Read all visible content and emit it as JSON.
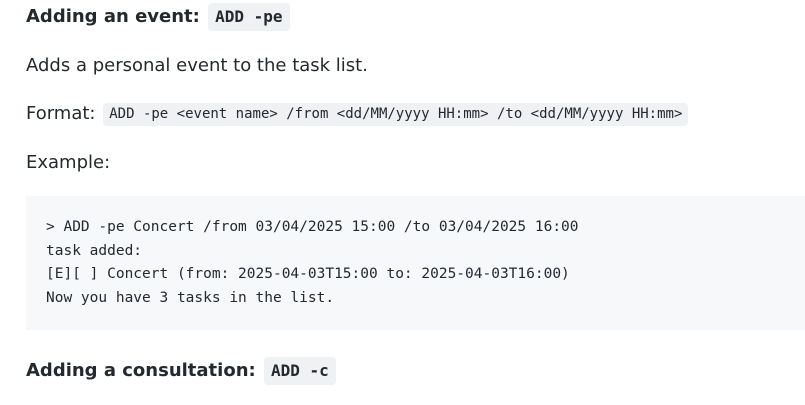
{
  "section_event": {
    "heading_text": "Adding an event:",
    "heading_code": "ADD -pe",
    "description": "Adds a personal event to the task list.",
    "format_label": "Format:",
    "format_code": "ADD -pe <event name> /from <dd/MM/yyyy HH:mm> /to <dd/MM/yyyy HH:mm>",
    "example_label": "Example:",
    "example_lines": [
      "> ADD -pe Concert /from 03/04/2025 15:00 /to 03/04/2025 16:00",
      "task added:",
      "[E][ ] Concert (from: 2025-04-03T15:00 to: 2025-04-03T16:00)",
      "Now you have 3 tasks in the list."
    ]
  },
  "section_consultation": {
    "heading_text": "Adding a consultation:",
    "heading_code": "ADD -c"
  }
}
